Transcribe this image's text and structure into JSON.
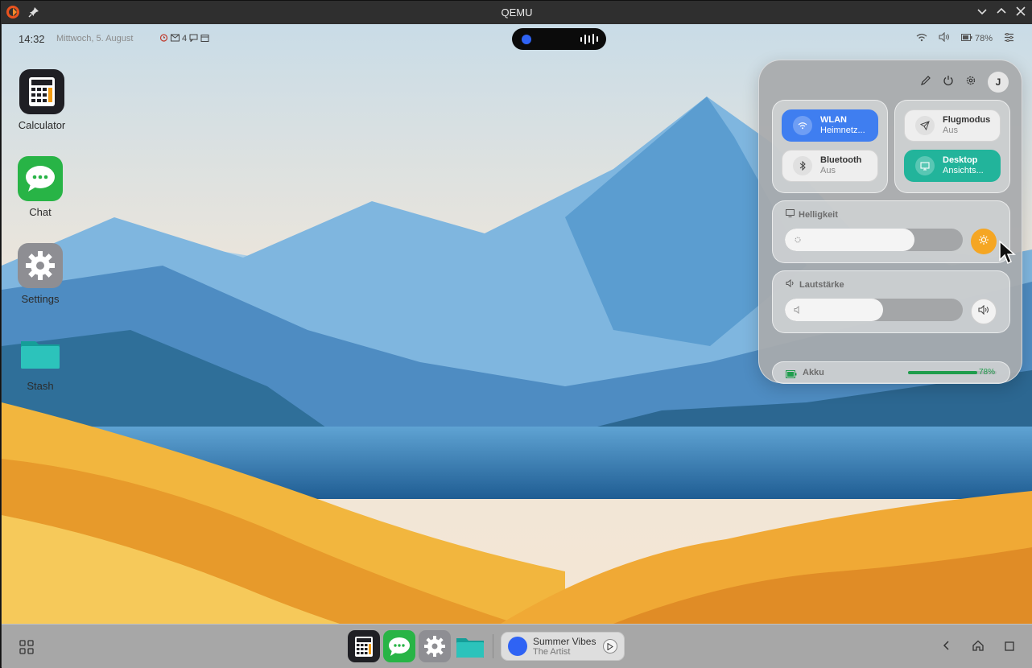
{
  "window": {
    "title": "QEMU"
  },
  "statusbar": {
    "time": "14:32",
    "date": "Mittwoch, 5. August",
    "mail_count": "4",
    "battery": "78%"
  },
  "desktop_icons": [
    {
      "label": "Calculator",
      "icon": "calculator-icon"
    },
    {
      "label": "Chat",
      "icon": "chat-icon"
    },
    {
      "label": "Settings",
      "icon": "gear-icon"
    },
    {
      "label": "Stash",
      "icon": "folder-icon"
    }
  ],
  "control_center": {
    "user_initial": "J",
    "toggles": [
      {
        "title": "WLAN",
        "subtitle": "Heimnetz...",
        "state": "on",
        "color": "#3f7ef0"
      },
      {
        "title": "Bluetooth",
        "subtitle": "Aus",
        "state": "off"
      },
      {
        "title": "Flugmodus",
        "subtitle": "Aus",
        "state": "off"
      },
      {
        "title": "Desktop",
        "subtitle": "Ansichts...",
        "state": "on",
        "color": "#22b49b"
      }
    ],
    "brightness": {
      "label": "Helligkeit",
      "level": 0.73,
      "button_color": "#f5a623"
    },
    "volume": {
      "label": "Lautstärke",
      "level": 0.55
    },
    "battery": {
      "label": "Akku",
      "value": "78%",
      "level": 0.78,
      "color": "#1f9d4c"
    }
  },
  "media": {
    "title": "Summer Vibes",
    "artist": "The Artist"
  },
  "colors": {
    "accent_blue": "#3f7ef0",
    "accent_teal": "#22b49b",
    "island_dot": "#2f63f4"
  }
}
